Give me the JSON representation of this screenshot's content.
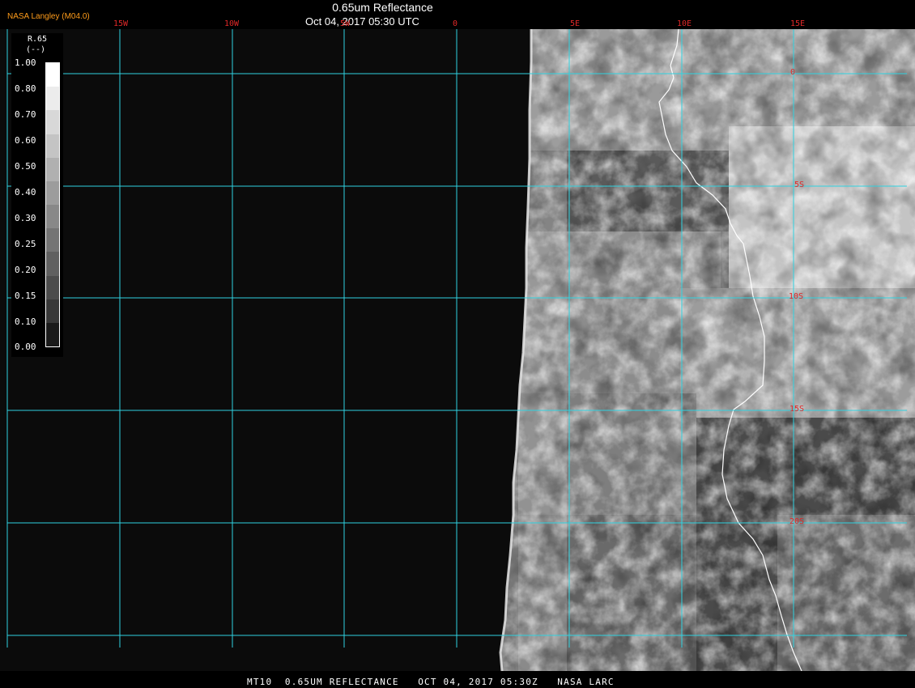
{
  "header": {
    "org": "NASA Langley (M04.0)",
    "title": "0.65um Reflectance",
    "subtitle": "Oct 04, 2017 05:30 UTC"
  },
  "footer": {
    "text": "MT10  0.65UM REFLECTANCE   OCT 04, 2017 05:30Z   NASA LARC"
  },
  "legend": {
    "variable": "R.65",
    "units": "(--)",
    "labels": [
      "1.00",
      "0.80",
      "0.70",
      "0.60",
      "0.50",
      "0.40",
      "0.30",
      "0.25",
      "0.20",
      "0.15",
      "0.10",
      "0.00"
    ],
    "gray_scale": [
      "#ffffff",
      "#ececec",
      "#d8d8d8",
      "#c4c4c4",
      "#b0b0b0",
      "#9c9c9c",
      "#888888",
      "#747474",
      "#606060",
      "#4c4c4c",
      "#383838",
      "#1a1a1a"
    ]
  },
  "map": {
    "longitude_labels": [
      "15W",
      "10W",
      "5W",
      "0",
      "5E",
      "10E",
      "15E"
    ],
    "latitude_labels": [
      "0",
      "5S",
      "10S",
      "15S",
      "20S"
    ],
    "grid_color": "#2fd2e0",
    "label_color": "#e02828",
    "coastline_color": "#ffffff",
    "space_color": "#0b0b0b"
  }
}
